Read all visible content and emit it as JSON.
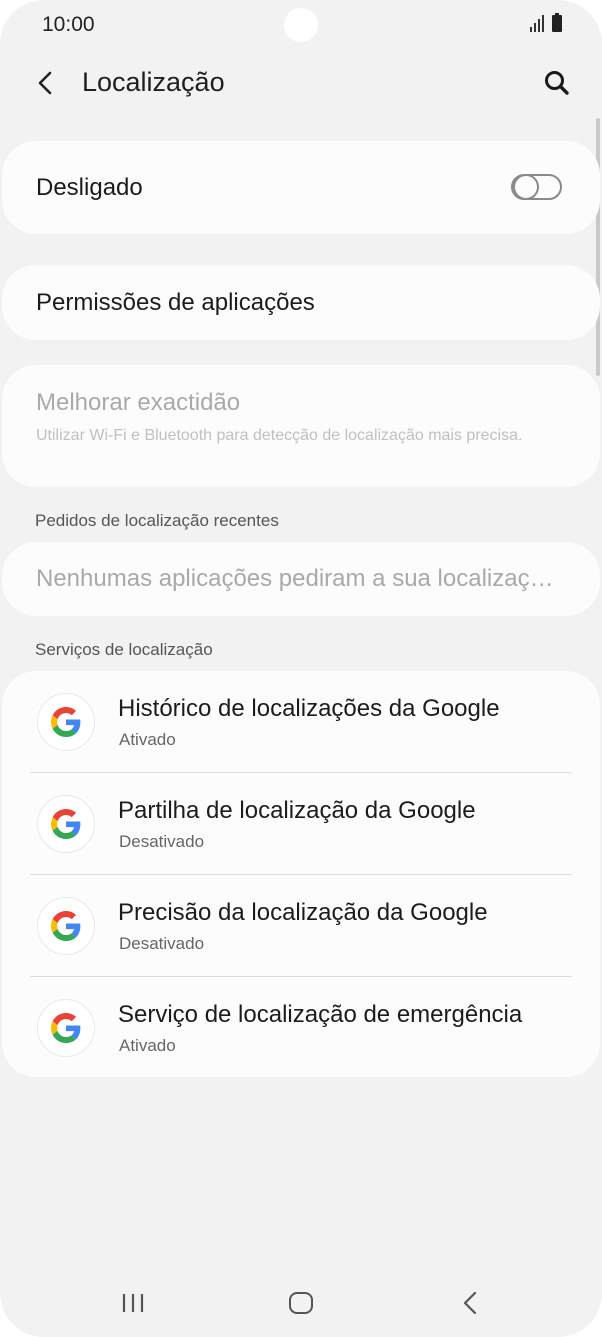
{
  "status_bar": {
    "time": "10:00"
  },
  "header": {
    "title": "Localização",
    "back_icon": "chevron-left-icon",
    "search_icon": "search-icon"
  },
  "location_toggle": {
    "label": "Desligado",
    "enabled": false
  },
  "app_permissions": {
    "label": "Permissões de aplicações"
  },
  "improve_accuracy": {
    "title": "Melhorar exactidão",
    "subtitle": "Utilizar Wi-Fi e Bluetooth para detecção de localização mais precisa."
  },
  "recent_requests": {
    "header": "Pedidos de localização recentes",
    "empty_text": "Nenhumas aplicações pediram a sua localização recentemente"
  },
  "location_services": {
    "header": "Serviços de localização",
    "items": [
      {
        "title": "Histórico de localizações da Google",
        "status": "Ativado",
        "icon": "google-icon"
      },
      {
        "title": "Partilha de localização da Google",
        "status": "Desativado",
        "icon": "google-icon"
      },
      {
        "title": "Precisão da localização da Google",
        "status": "Desativado",
        "icon": "google-icon"
      },
      {
        "title": "Serviço de localização de emergência",
        "status": "Ativado",
        "icon": "google-icon"
      }
    ]
  },
  "colors": {
    "background": "#f2f2f2",
    "card": "#fcfcfc",
    "text_primary": "#1c1c1c",
    "text_disabled": "#a9a9a9"
  }
}
